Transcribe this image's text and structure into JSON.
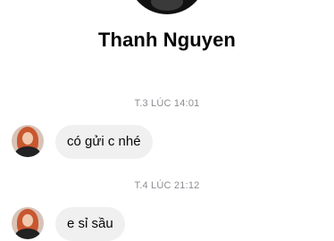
{
  "contact": {
    "name": "Thanh Nguyen"
  },
  "messages": [
    {
      "timestamp": "T.3 LÚC 14:01",
      "text": "có gửi c nhé"
    },
    {
      "timestamp": "T.4 LÚC 21:12",
      "text": "e sỉ sầu"
    }
  ],
  "colors": {
    "background": "#ffffff",
    "bubble": "#f0f0f0",
    "timestamp": "#8a8d91",
    "text": "#050505"
  }
}
